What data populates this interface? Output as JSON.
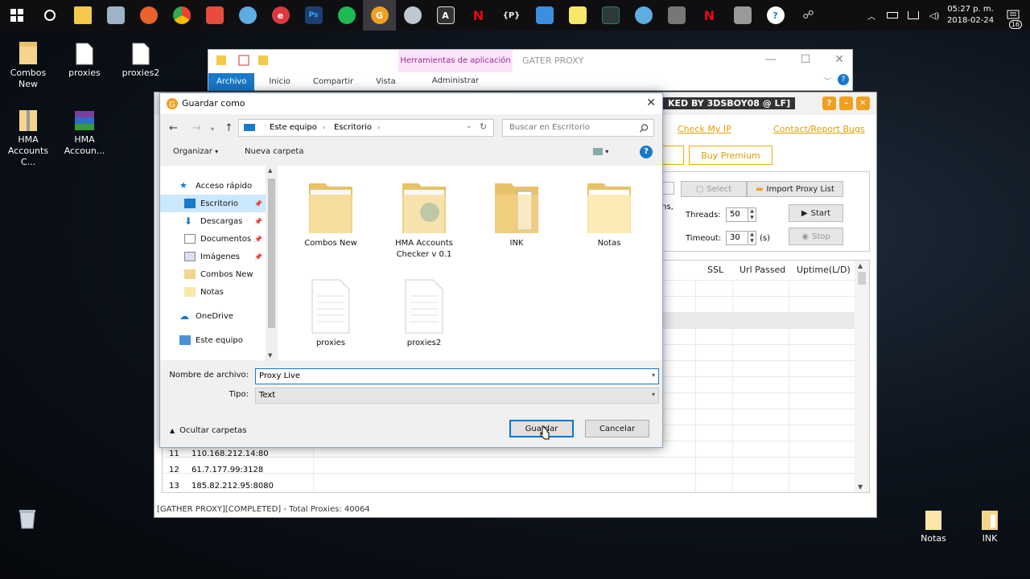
{
  "taskbar": {
    "apps": [
      {
        "icon": "windows-start-icon",
        "color": "#ffffff"
      },
      {
        "icon": "cortana-icon",
        "color": "#ffffff"
      },
      {
        "icon": "file-explorer-icon",
        "color": "#f2c94c"
      },
      {
        "icon": "notes-app-icon",
        "color": "#9fb3c8"
      },
      {
        "icon": "firefox-icon",
        "color": "#e8622a"
      },
      {
        "icon": "chrome-icon",
        "color": "#34a853"
      },
      {
        "icon": "paint-brush-app-icon",
        "color": "#e74c3c"
      },
      {
        "icon": "globe-app-icon",
        "color": "#5dade2"
      },
      {
        "icon": "express-vpn-icon",
        "color": "#da3940"
      },
      {
        "icon": "photoshop-icon",
        "color": "#1c5fa8"
      },
      {
        "icon": "spotify-icon",
        "color": "#1db954"
      },
      {
        "icon": "gather-proxy-icon",
        "color": "#f0a020",
        "active": true
      },
      {
        "icon": "steam-icon",
        "color": "#bfc8d2"
      },
      {
        "icon": "text-editor-icon",
        "color": "#dddddd"
      },
      {
        "icon": "netflix-icon",
        "color": "#e50914"
      },
      {
        "icon": "braces-app-icon",
        "color": "#eeeeee"
      },
      {
        "icon": "sync-app-icon",
        "color": "#3b8ee0"
      },
      {
        "icon": "sticky-notes-icon",
        "color": "#f7e86a"
      },
      {
        "icon": "terminal-icon",
        "color": "#2c7a6a"
      },
      {
        "icon": "globe-app-2-icon",
        "color": "#5dade2"
      },
      {
        "icon": "tool-app-icon",
        "color": "#cccccc"
      },
      {
        "icon": "netflix-2-icon",
        "color": "#e50914"
      },
      {
        "icon": "shield-app-icon",
        "color": "#bbbbbb"
      },
      {
        "icon": "help-icon",
        "color": "#ffffff"
      },
      {
        "icon": "people-icon",
        "color": "#cccccc"
      }
    ],
    "letters": {
      "vpn": "e",
      "ps": "Ps",
      "gp": "G",
      "text": "A",
      "netflix": "N",
      "braces": "{P}"
    },
    "clock": {
      "time": "05:27 p. m.",
      "date": "2018-02-24"
    },
    "notifications_count": "16"
  },
  "desktop": {
    "icons": [
      {
        "label": "Combos New"
      },
      {
        "label": "proxies"
      },
      {
        "label": "proxies2"
      },
      {
        "label": "HMA Accounts C..."
      },
      {
        "label": "HMA Accoun..."
      },
      {
        "label": "Notas"
      },
      {
        "label": "INK"
      }
    ]
  },
  "explorer": {
    "tools_tab": "Herramientas de aplicación",
    "manage_tab": "Administrar",
    "title": "GATER PROXY",
    "tabs": [
      "Archivo",
      "Inicio",
      "Compartir",
      "Vista"
    ]
  },
  "gather_proxy": {
    "title": "KED BY 3DSBOY08 @ LF]",
    "check_ip": "Check My IP",
    "contact": "Contact/Report Bugs",
    "buy_premium": "Buy Premium",
    "select": "Select",
    "import_list": "Import Proxy List",
    "threads_label": "Threads:",
    "threads_value": "50",
    "timeout_label": "Timeout:",
    "timeout_value": "30",
    "timeout_unit": "(s)",
    "start": "Start",
    "stop": "Stop",
    "partial_text": "ons,",
    "columns": [
      "SSL",
      "Url Passed",
      "Uptime(L/D)"
    ],
    "rows": [
      {
        "num": "11",
        "ip": "110.168.212.14:80"
      },
      {
        "num": "12",
        "ip": "61.7.177.99:3128"
      },
      {
        "num": "13",
        "ip": "185.82.212.95:8080"
      }
    ],
    "status": "[GATHER PROXY][COMPLETED] - Total Proxies: 40064"
  },
  "save_dialog": {
    "title": "Guardar como",
    "breadcrumb": [
      "Este equipo",
      "Escritorio"
    ],
    "search_placeholder": "Buscar en Escritorio",
    "organize": "Organizar",
    "new_folder": "Nueva carpeta",
    "nav": [
      {
        "label": "Acceso rápido",
        "icon": "star-icon"
      },
      {
        "label": "Escritorio",
        "icon": "desktop-icon",
        "pinned": true,
        "selected": true
      },
      {
        "label": "Descargas",
        "icon": "download-icon",
        "pinned": true
      },
      {
        "label": "Documentos",
        "icon": "documents-icon",
        "pinned": true
      },
      {
        "label": "Imágenes",
        "icon": "images-icon",
        "pinned": true
      },
      {
        "label": "Combos New",
        "icon": "folder-icon"
      },
      {
        "label": "Notas",
        "icon": "folder-icon"
      },
      {
        "label": "OneDrive",
        "icon": "onedrive-icon"
      },
      {
        "label": "Este equipo",
        "icon": "computer-icon"
      }
    ],
    "files": [
      {
        "label": "Combos New",
        "type": "folder"
      },
      {
        "label": "HMA Accounts Checker v 0.1",
        "type": "folder-app"
      },
      {
        "label": "INK",
        "type": "folder-doc"
      },
      {
        "label": "Notas",
        "type": "folder"
      },
      {
        "label": "proxies",
        "type": "text"
      },
      {
        "label": "proxies2",
        "type": "text"
      }
    ],
    "filename_label": "Nombre de archivo:",
    "filename_value": "Proxy Live",
    "type_label": "Tipo:",
    "type_value": "Text",
    "hide_folders": "Ocultar carpetas",
    "save": "Guardar",
    "cancel": "Cancelar"
  }
}
